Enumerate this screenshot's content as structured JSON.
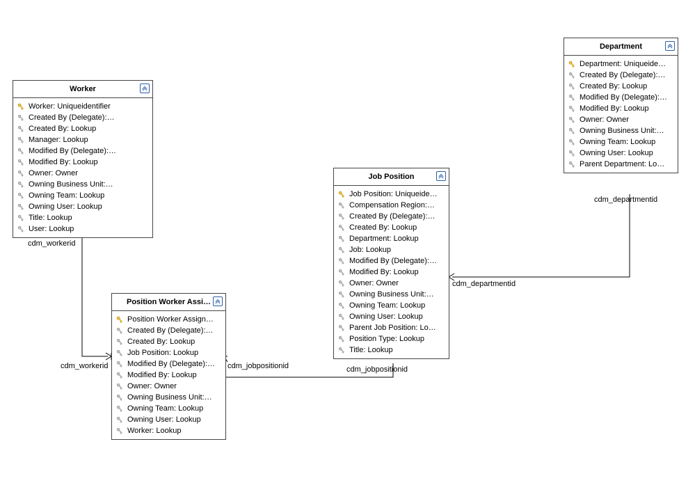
{
  "entities": {
    "worker": {
      "title": "Worker",
      "attrs": [
        {
          "icon": "key",
          "text": "Worker: Uniqueidentifier"
        },
        {
          "icon": "lookup",
          "text": "Created By (Delegate):…"
        },
        {
          "icon": "lookup",
          "text": "Created By: Lookup"
        },
        {
          "icon": "lookup",
          "text": "Manager: Lookup"
        },
        {
          "icon": "lookup",
          "text": "Modified By (Delegate):…"
        },
        {
          "icon": "lookup",
          "text": "Modified By: Lookup"
        },
        {
          "icon": "lookup",
          "text": "Owner: Owner"
        },
        {
          "icon": "lookup",
          "text": "Owning Business Unit:…"
        },
        {
          "icon": "lookup",
          "text": "Owning Team: Lookup"
        },
        {
          "icon": "lookup",
          "text": "Owning User: Lookup"
        },
        {
          "icon": "lookup",
          "text": "Title: Lookup"
        },
        {
          "icon": "lookup",
          "text": "User: Lookup"
        }
      ]
    },
    "pwa": {
      "title": "Position Worker Assi…",
      "attrs": [
        {
          "icon": "key",
          "text": "Position Worker Assign…"
        },
        {
          "icon": "lookup",
          "text": "Created By (Delegate):…"
        },
        {
          "icon": "lookup",
          "text": "Created By: Lookup"
        },
        {
          "icon": "lookup",
          "text": "Job Position: Lookup"
        },
        {
          "icon": "lookup",
          "text": "Modified By (Delegate):…"
        },
        {
          "icon": "lookup",
          "text": "Modified By: Lookup"
        },
        {
          "icon": "lookup",
          "text": "Owner: Owner"
        },
        {
          "icon": "lookup",
          "text": "Owning Business Unit:…"
        },
        {
          "icon": "lookup",
          "text": "Owning Team: Lookup"
        },
        {
          "icon": "lookup",
          "text": "Owning User: Lookup"
        },
        {
          "icon": "lookup",
          "text": "Worker: Lookup"
        }
      ]
    },
    "jobposition": {
      "title": "Job Position",
      "attrs": [
        {
          "icon": "key",
          "text": "Job Position: Uniqueide…"
        },
        {
          "icon": "lookup",
          "text": "Compensation Region:…"
        },
        {
          "icon": "lookup",
          "text": "Created By (Delegate):…"
        },
        {
          "icon": "lookup",
          "text": "Created By: Lookup"
        },
        {
          "icon": "lookup",
          "text": "Department: Lookup"
        },
        {
          "icon": "lookup",
          "text": "Job: Lookup"
        },
        {
          "icon": "lookup",
          "text": "Modified By (Delegate):…"
        },
        {
          "icon": "lookup",
          "text": "Modified By: Lookup"
        },
        {
          "icon": "lookup",
          "text": "Owner: Owner"
        },
        {
          "icon": "lookup",
          "text": "Owning Business Unit:…"
        },
        {
          "icon": "lookup",
          "text": "Owning Team: Lookup"
        },
        {
          "icon": "lookup",
          "text": "Owning User: Lookup"
        },
        {
          "icon": "lookup",
          "text": "Parent Job Position: Lo…"
        },
        {
          "icon": "lookup",
          "text": "Position Type: Lookup"
        },
        {
          "icon": "lookup",
          "text": "Title: Lookup"
        }
      ]
    },
    "department": {
      "title": "Department",
      "attrs": [
        {
          "icon": "key",
          "text": "Department: Uniqueide…"
        },
        {
          "icon": "lookup",
          "text": "Created By (Delegate):…"
        },
        {
          "icon": "lookup",
          "text": "Created By: Lookup"
        },
        {
          "icon": "lookup",
          "text": "Modified By (Delegate):…"
        },
        {
          "icon": "lookup",
          "text": "Modified By: Lookup"
        },
        {
          "icon": "lookup",
          "text": "Owner: Owner"
        },
        {
          "icon": "lookup",
          "text": "Owning Business Unit:…"
        },
        {
          "icon": "lookup",
          "text": "Owning Team: Lookup"
        },
        {
          "icon": "lookup",
          "text": "Owning User: Lookup"
        },
        {
          "icon": "lookup",
          "text": "Parent Department: Lo…"
        }
      ]
    }
  },
  "labels": {
    "worker_down": "cdm_workerid",
    "pwa_left": "cdm_workerid",
    "pwa_right": "cdm_jobpositionid",
    "job_down": "cdm_jobpositionid",
    "job_right": "cdm_departmentid",
    "dept_down": "cdm_departmentid"
  }
}
